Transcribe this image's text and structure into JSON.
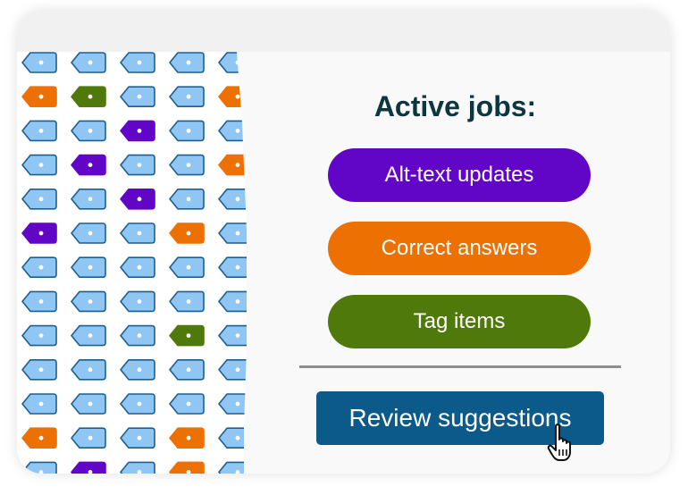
{
  "panel": {
    "heading": "Active jobs:",
    "jobs": [
      {
        "label": "Alt-text updates",
        "color": "#6106c6"
      },
      {
        "label": "Correct answers",
        "color": "#ed7002"
      },
      {
        "label": "Tag items",
        "color": "#4f7a0b"
      }
    ],
    "review_label": "Review suggestions",
    "review_color": "#0c5a8a"
  },
  "tag_grid": {
    "icon": "tag-icon",
    "colors": {
      "b": "#8fc6f3",
      "o": "#ed7002",
      "g": "#4f7a0b",
      "p": "#6106c6"
    },
    "rows": [
      "bbbbb",
      "ogbbo",
      "bbpbb",
      "bpbbo",
      "bbpbb",
      "pbbob",
      "bbbbb",
      "bbbbb",
      "bbbgb",
      "bbbbb",
      "bbbbb",
      "obbob",
      "bpbob"
    ]
  },
  "cursor": {
    "icon": "hand-pointer-icon"
  }
}
